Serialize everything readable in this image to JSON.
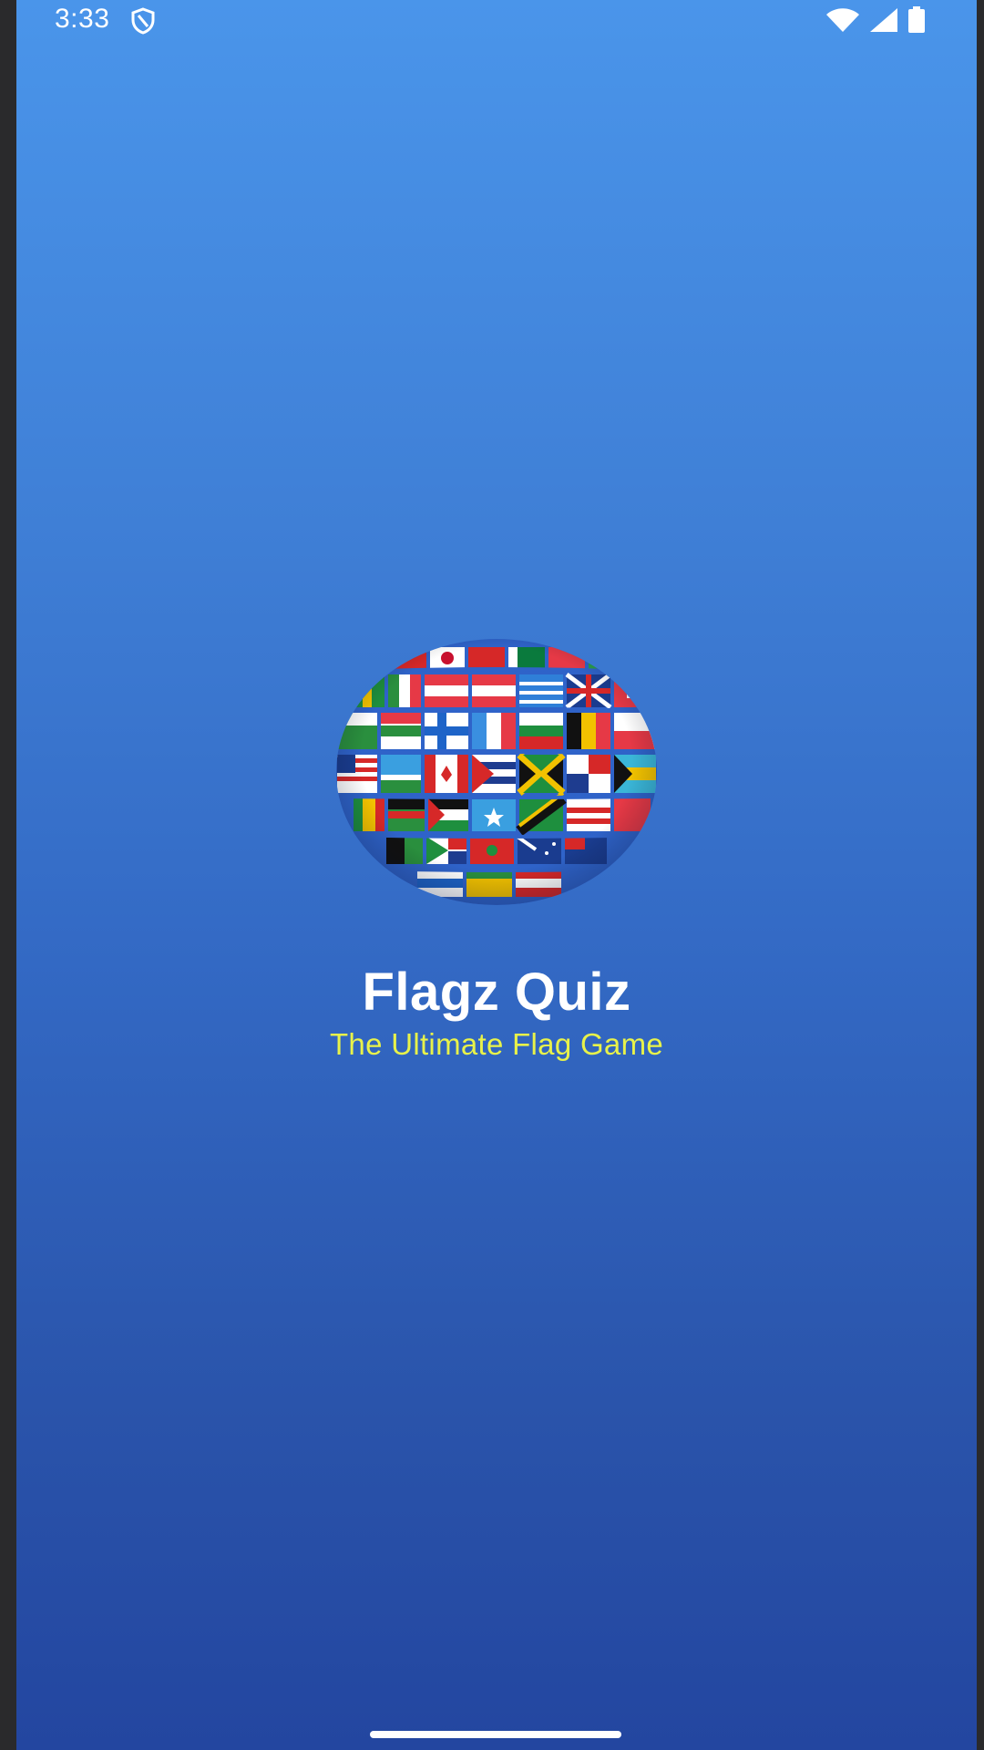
{
  "status_bar": {
    "time": "3:33",
    "left_icons": [
      "shield-icon"
    ],
    "right_icons": [
      "wifi-icon",
      "cellular-signal-icon",
      "battery-icon"
    ]
  },
  "splash": {
    "logo_icon": "flag-globe-logo",
    "title": "Flagz Quiz",
    "subtitle": "The Ultimate Flag Game"
  },
  "colors": {
    "background_top": "#4a95ea",
    "background_bottom": "#2346a0",
    "title_color": "#ffffff",
    "subtitle_color": "#e8f24a"
  }
}
